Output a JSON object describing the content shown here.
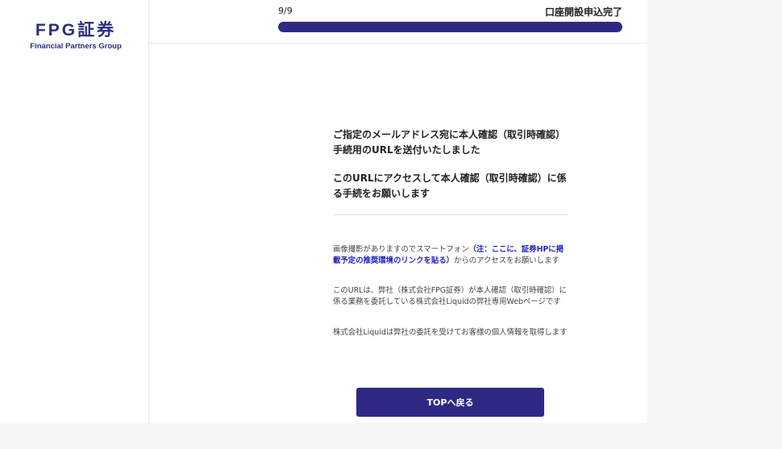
{
  "logo": {
    "main": "FPG証券",
    "sub": "Financial Partners Group"
  },
  "header": {
    "step": "9/9",
    "status_title": "口座開設申込完了",
    "progress_fraction": 1.0
  },
  "content": {
    "lead1": "ご指定のメールアドレス宛に本人確認（取引時確認）手続用のURLを送付いたしました",
    "lead2": "このURLにアクセスして本人確認（取引時確認）に係る手続をお願いします",
    "note1_before": "画像撮影がありますのでスマートフォン",
    "note1_link": "（注：ここに、証券HPに掲載予定の推奨環境のリンクを貼る）",
    "note1_after": "からのアクセスをお願いします",
    "note2": "このURLは、弊社（株式会社FPG証券）が本人確認（取引時確認）に係る業務を委託している株式会社Liquidの弊社専用Webページです",
    "note3": "株式会社Liquidは弊社の委託を受けてお客様の個人情報を取得します"
  },
  "button": {
    "top_label": "TOPへ戻る"
  },
  "colors": {
    "brand": "#2e2a84",
    "link": "#2222c8"
  }
}
